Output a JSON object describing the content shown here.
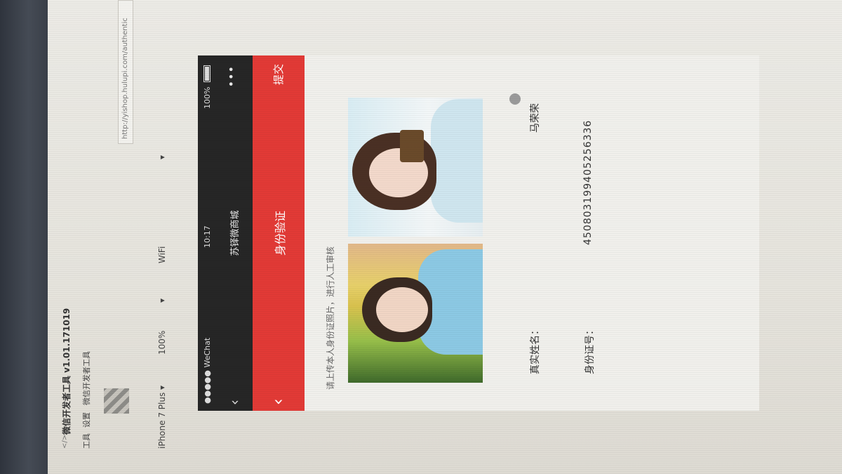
{
  "devtools": {
    "title": "微信开发者工具 v1.01.171019",
    "menu": [
      "工具",
      "设置",
      "微信开发者工具"
    ],
    "device": "iPhone 7 Plus",
    "zoom": "100%",
    "network": "WiFi",
    "url": "http://yishop.hulupi.com/authentic"
  },
  "phone": {
    "carrier": "●●●●● WeChat",
    "time": "10:17",
    "battery": "100%",
    "nav_title": "苏铎微商城",
    "page_title": "身份验证",
    "submit_label": "提交",
    "hint": "请上传本人身份证照片，进行人工审核",
    "name_label": "真实姓名：",
    "name_value": "马荣荣",
    "id_label": "身份证号：",
    "id_value": "450803199405256336"
  },
  "icons": {
    "back": "chevron-left-icon",
    "more": "more-dots-icon",
    "battery": "battery-icon"
  },
  "colors": {
    "accent": "#e23a36",
    "statusbar": "#262626"
  }
}
